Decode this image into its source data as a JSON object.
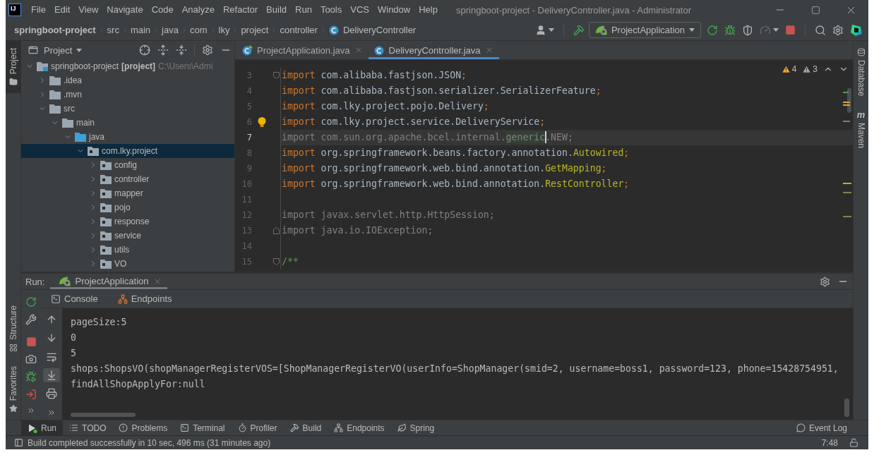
{
  "app_logo": "IJ",
  "menu": [
    "File",
    "Edit",
    "View",
    "Navigate",
    "Code",
    "Analyze",
    "Refactor",
    "Build",
    "Run",
    "Tools",
    "VCS",
    "Window",
    "Help"
  ],
  "window": {
    "title": "springboot-project - DeliveryController.java - Administrator"
  },
  "breadcrumbs": [
    {
      "label": "springboot-project",
      "kind": "project"
    },
    {
      "label": "src",
      "kind": "folder"
    },
    {
      "label": "main",
      "kind": "folder"
    },
    {
      "label": "java",
      "kind": "folder"
    },
    {
      "label": "com",
      "kind": "folder"
    },
    {
      "label": "lky",
      "kind": "folder"
    },
    {
      "label": "project",
      "kind": "folder"
    },
    {
      "label": "controller",
      "kind": "folder"
    },
    {
      "label": "DeliveryController",
      "kind": "class"
    }
  ],
  "run_configuration": "ProjectApplication",
  "left_stripe": {
    "top": [
      {
        "label": "Project",
        "selected": true
      }
    ],
    "bottom": [
      {
        "label": "Structure",
        "selected": false
      },
      {
        "label": "Favorites",
        "selected": false
      }
    ]
  },
  "project_panel": {
    "title": "Project",
    "tree": [
      {
        "label": "springboot-project",
        "module_tag": "[project]",
        "path": "C:\\Users\\Admi",
        "kind": "module",
        "expanded": true,
        "selected": false,
        "children": [
          {
            "label": ".idea",
            "kind": "folder",
            "expanded": false,
            "selected": false
          },
          {
            "label": ".mvn",
            "kind": "folder",
            "expanded": false,
            "selected": false
          },
          {
            "label": "src",
            "kind": "folder",
            "expanded": true,
            "selected": false,
            "children": [
              {
                "label": "main",
                "kind": "folder",
                "expanded": true,
                "selected": false,
                "children": [
                  {
                    "label": "java",
                    "kind": "source_root",
                    "expanded": true,
                    "selected": false,
                    "children": [
                      {
                        "label": "com.lky.project",
                        "kind": "package",
                        "expanded": true,
                        "selected": true,
                        "children": [
                          {
                            "label": "config",
                            "kind": "package",
                            "expanded": false,
                            "selected": false
                          },
                          {
                            "label": "controller",
                            "kind": "package",
                            "expanded": false,
                            "selected": false
                          },
                          {
                            "label": "mapper",
                            "kind": "package",
                            "expanded": false,
                            "selected": false
                          },
                          {
                            "label": "pojo",
                            "kind": "package",
                            "expanded": false,
                            "selected": false
                          },
                          {
                            "label": "response",
                            "kind": "package",
                            "expanded": false,
                            "selected": false
                          },
                          {
                            "label": "service",
                            "kind": "package",
                            "expanded": false,
                            "selected": false
                          },
                          {
                            "label": "utils",
                            "kind": "package",
                            "expanded": false,
                            "selected": false
                          },
                          {
                            "label": "VO",
                            "kind": "package",
                            "expanded": false,
                            "selected": false
                          }
                        ]
                      }
                    ]
                  }
                ]
              }
            ]
          }
        ]
      }
    ]
  },
  "editor": {
    "tabs": [
      {
        "label": "ProjectApplication.java",
        "kind": "spring_class",
        "selected": false
      },
      {
        "label": "DeliveryController.java",
        "kind": "class",
        "selected": true
      }
    ],
    "warnings": "4",
    "weak_warnings": "3",
    "lines": [
      {
        "number": "3",
        "fold_open": true,
        "fold_close": false,
        "current": false,
        "bulb": false,
        "tokens": [
          {
            "text": "import",
            "kind": "keyword"
          },
          {
            "text": " com.alibaba.fastjson.JSON",
            "kind": "plain"
          },
          {
            "text": ";",
            "kind": "keyword"
          }
        ]
      },
      {
        "number": "4",
        "fold_open": false,
        "fold_close": false,
        "current": false,
        "bulb": false,
        "tokens": [
          {
            "text": "import",
            "kind": "keyword"
          },
          {
            "text": " com.alibaba.fastjson.serializer.SerializerFeature",
            "kind": "plain"
          },
          {
            "text": ";",
            "kind": "keyword"
          }
        ]
      },
      {
        "number": "5",
        "fold_open": false,
        "fold_close": false,
        "current": false,
        "bulb": false,
        "tokens": [
          {
            "text": "import",
            "kind": "keyword"
          },
          {
            "text": " com.lky.project.pojo.Delivery",
            "kind": "plain"
          },
          {
            "text": ";",
            "kind": "keyword"
          }
        ]
      },
      {
        "number": "6",
        "fold_open": false,
        "fold_close": false,
        "current": false,
        "bulb": true,
        "tokens": [
          {
            "text": "import",
            "kind": "keyword"
          },
          {
            "text": " com.lky.project.service.DeliveryService",
            "kind": "plain"
          },
          {
            "text": ";",
            "kind": "keyword"
          }
        ]
      },
      {
        "number": "7",
        "fold_open": false,
        "fold_close": false,
        "current": true,
        "bulb": false,
        "tokens": [
          {
            "text": "import com.sun.org.apache.bcel.internal.",
            "kind": "unused"
          },
          {
            "text": "generic",
            "kind": "match_at_caret"
          },
          {
            "text": ".NEW;",
            "kind": "unused"
          }
        ]
      },
      {
        "number": "8",
        "fold_open": false,
        "fold_close": false,
        "current": false,
        "bulb": false,
        "tokens": [
          {
            "text": "import",
            "kind": "keyword"
          },
          {
            "text": " org.springframework.beans.factory.annotation.",
            "kind": "plain"
          },
          {
            "text": "Autowired",
            "kind": "annotation"
          },
          {
            "text": ";",
            "kind": "keyword"
          }
        ]
      },
      {
        "number": "9",
        "fold_open": false,
        "fold_close": false,
        "current": false,
        "bulb": false,
        "tokens": [
          {
            "text": "import",
            "kind": "keyword"
          },
          {
            "text": " org.springframework.web.bind.annotation.",
            "kind": "plain"
          },
          {
            "text": "GetMapping",
            "kind": "annotation"
          },
          {
            "text": ";",
            "kind": "keyword"
          }
        ]
      },
      {
        "number": "10",
        "fold_open": false,
        "fold_close": false,
        "current": false,
        "bulb": false,
        "tokens": [
          {
            "text": "import",
            "kind": "keyword"
          },
          {
            "text": " org.springframework.web.bind.annotation.",
            "kind": "plain"
          },
          {
            "text": "RestController",
            "kind": "annotation"
          },
          {
            "text": ";",
            "kind": "keyword"
          }
        ]
      },
      {
        "number": "11",
        "fold_open": false,
        "fold_close": false,
        "current": false,
        "bulb": false
      },
      {
        "number": "12",
        "fold_open": false,
        "fold_close": false,
        "current": false,
        "bulb": false,
        "tokens": [
          {
            "text": "import javax.servlet.http.HttpSession;",
            "kind": "unused"
          }
        ]
      },
      {
        "number": "13",
        "fold_open": false,
        "fold_close": true,
        "current": false,
        "bulb": false,
        "tokens": [
          {
            "text": "import java.io.IOException;",
            "kind": "unused"
          }
        ]
      },
      {
        "number": "14",
        "fold_open": false,
        "fold_close": false,
        "current": false,
        "bulb": false
      },
      {
        "number": "15",
        "fold_open": true,
        "fold_close": false,
        "current": false,
        "bulb": false,
        "tokens": [
          {
            "text": "/**",
            "kind": "comment"
          }
        ]
      }
    ]
  },
  "right_stripe": [
    {
      "label": "Database",
      "kind": "database"
    },
    {
      "label": "Maven",
      "kind": "maven",
      "glyph": "m"
    }
  ],
  "run_panel": {
    "label": "Run:",
    "tabs": [
      {
        "label": "ProjectApplication",
        "selected": true
      }
    ],
    "subtabs": [
      {
        "label": "Console",
        "kind": "console"
      },
      {
        "label": "Endpoints",
        "kind": "endpoints"
      }
    ],
    "scroll_to_end": true,
    "output": [
      "pageSize:5",
      "0",
      "5",
      "shops:ShopsVO(shopManagerRegisterVOS=[ShopManagerRegisterVO(userInfo=ShopManager(smid=2, username=boss1, password=123, phone=15428754951,",
      "findAllShopApplyFor:null"
    ]
  },
  "tool_windows": [
    {
      "label": "Run",
      "kind": "run",
      "selected": true
    },
    {
      "label": "TODO",
      "kind": "todo",
      "selected": false
    },
    {
      "label": "Problems",
      "kind": "problems",
      "selected": false
    },
    {
      "label": "Terminal",
      "kind": "terminal",
      "selected": false
    },
    {
      "label": "Profiler",
      "kind": "profiler",
      "selected": false
    },
    {
      "label": "Build",
      "kind": "build",
      "selected": false
    },
    {
      "label": "Endpoints",
      "kind": "endpoints",
      "selected": false
    },
    {
      "label": "Spring",
      "kind": "spring",
      "selected": false
    }
  ],
  "event_log": "Event Log",
  "status_bar": {
    "message": "Build completed successfully in 10 sec, 496 ms (31 minutes ago)",
    "caret_position": "7:48"
  }
}
